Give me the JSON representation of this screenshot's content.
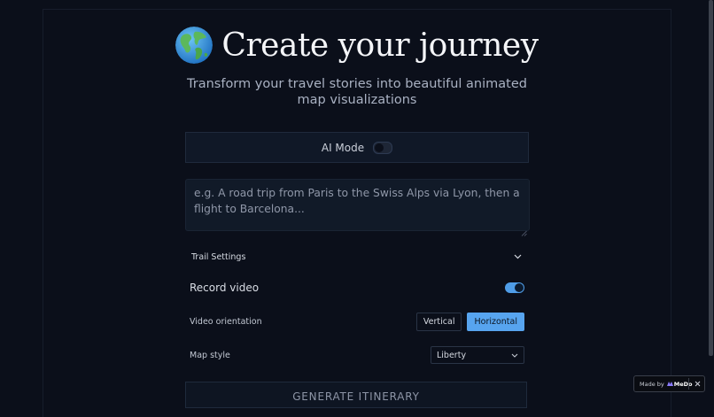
{
  "header": {
    "title": "Create your journey",
    "subtitle": "Transform your travel stories into beautiful animated map visualizations",
    "icon": "globe-icon"
  },
  "ai_mode": {
    "label": "AI Mode",
    "enabled": false
  },
  "prompt": {
    "placeholder": "e.g. A road trip from Paris to the Swiss Alps via Lyon, then a flight to Barcelona...",
    "value": ""
  },
  "trail_settings": {
    "label": "Trail Settings",
    "icon": "chevron-down-icon"
  },
  "record_video": {
    "label": "Record video",
    "enabled": true
  },
  "video_orientation": {
    "label": "Video orientation",
    "options": [
      "Vertical",
      "Horizontal"
    ],
    "selected": "Horizontal"
  },
  "map_style": {
    "label": "Map style",
    "selected": "Liberty"
  },
  "generate_button": {
    "label": "GENERATE ITINERARY"
  },
  "badge": {
    "prefix": "Made by",
    "brand": "MeDo"
  },
  "colors": {
    "background": "#0b0f1a",
    "accent": "#57a4ef",
    "panel": "#101827"
  }
}
